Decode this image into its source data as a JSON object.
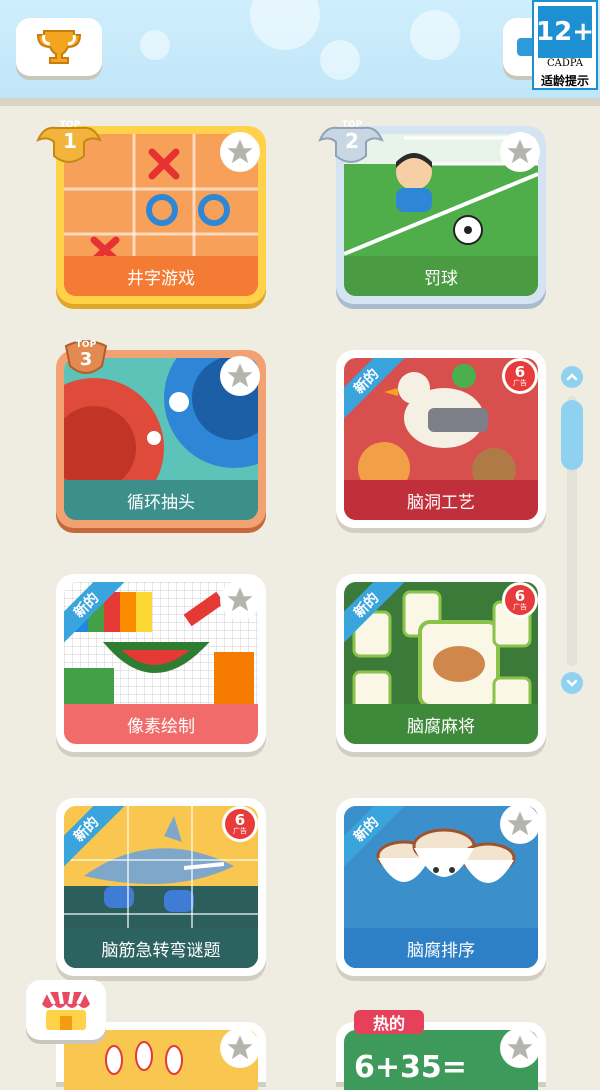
{
  "age_rating": {
    "badge": "12+",
    "org": "CADPA",
    "tip": "适龄提示"
  },
  "games": [
    {
      "title": "井字游戏",
      "rank": "TOP",
      "rank_num": "1",
      "label_color": "#f37b33"
    },
    {
      "title": "罚球",
      "rank": "TOP",
      "rank_num": "2",
      "label_color": "#4b9b43"
    },
    {
      "title": "循环抽头",
      "rank": "TOP",
      "rank_num": "3",
      "label_color": "#3c8f8b"
    },
    {
      "title": "脑洞工艺",
      "tag": "新的",
      "ad": "6",
      "ad_small": "广告",
      "label_color": "#c0303a"
    },
    {
      "title": "像素绘制",
      "tag": "新的",
      "label_color": "#f26b6b"
    },
    {
      "title": "脑腐麻将",
      "tag": "新的",
      "ad": "6",
      "ad_small": "广告",
      "label_color": "#3f8a3a"
    },
    {
      "title": "脑筋急转弯谜题",
      "tag": "新的",
      "ad": "6",
      "ad_small": "广告",
      "label_color": "#2c6360"
    },
    {
      "title": "脑腐排序",
      "tag": "新的",
      "label_color": "#2d7fc6"
    }
  ],
  "bottom_row": {
    "tag_hot": "热的",
    "partial_text": "6+35="
  },
  "icons": [
    "trophy-icon",
    "star-icon",
    "shop-icon",
    "chevron-up-icon",
    "chevron-down-icon"
  ]
}
